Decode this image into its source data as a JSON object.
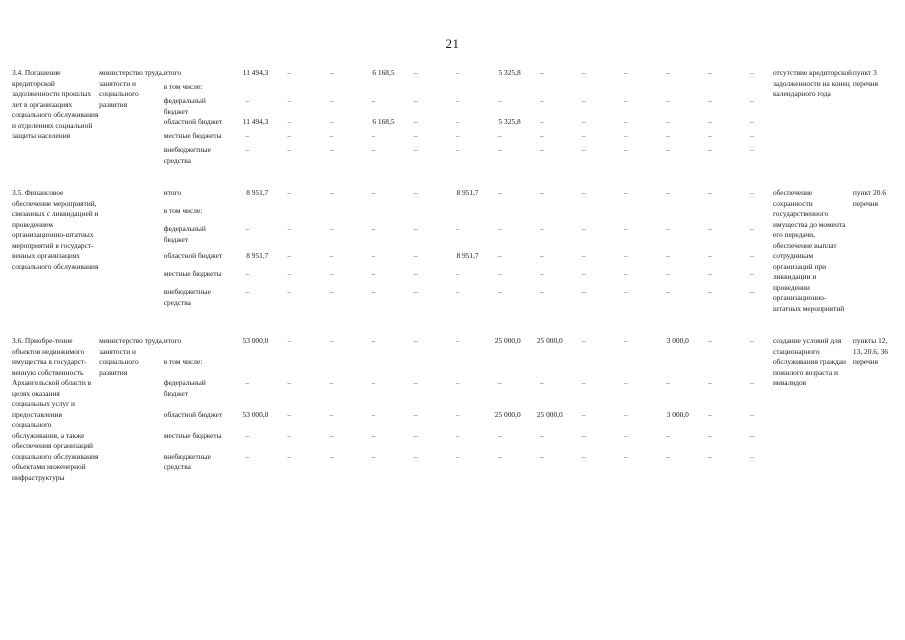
{
  "page": {
    "number": "21"
  },
  "table": {
    "columns": [
      "name",
      "executor",
      "funding_source",
      "total",
      "y1",
      "y2",
      "y3",
      "y4",
      "y5",
      "y6",
      "y7",
      "y8",
      "y9",
      "y10",
      "y11",
      "y12",
      "result",
      "item"
    ],
    "source_labels": [
      "итого",
      "в том числе:",
      "федеральный бюджет",
      "областной бюджет",
      "местные бюджеты",
      "внебюджетные средства"
    ],
    "rows": [
      {
        "name": "3.4. Погашение кредиторской задолженности прошлых лет в организациях социального обслуживания и отделениях социальной защиты населения",
        "executor": "министерство труда, занятости и социального развития",
        "result": "отсутствие кредиторской задолженности на конец календарного года",
        "item": "пункт 3 перечня",
        "values": {
          "итого": [
            "11 494,3",
            "–",
            "–",
            "6 168,5",
            "–",
            "–",
            "5 325,8",
            "–",
            "–",
            "–",
            "–",
            "–",
            "–"
          ],
          "в том числе:": [
            "",
            "",
            "",
            "",
            "",
            "",
            "",
            "",
            "",
            "",
            "",
            "",
            ""
          ],
          "федеральный бюджет": [
            "–",
            "–",
            "–",
            "–",
            "–",
            "–",
            "–",
            "–",
            "–",
            "–",
            "–",
            "–",
            "–"
          ],
          "областной бюджет": [
            "11 494,3",
            "–",
            "–",
            "6 168,5",
            "–",
            "–",
            "5 325,8",
            "–",
            "–",
            "–",
            "–",
            "–",
            "–"
          ],
          "местные бюджеты": [
            "–",
            "–",
            "–",
            "–",
            "–",
            "–",
            "–",
            "–",
            "–",
            "–",
            "–",
            "–",
            "–"
          ],
          "внебюджетные средства": [
            "–",
            "–",
            "–",
            "–",
            "–",
            "–",
            "–",
            "–",
            "–",
            "–",
            "–",
            "–",
            "–"
          ]
        }
      },
      {
        "name": "3.5. Финансовое обеспечение мероприятий, связанных с ликвидацией и проведением организационно-штатных мероприятий в государст-венных организациях социального обслуживания",
        "executor": "",
        "result": "обеспечение сохранности государственного имущества до момента его передачи, обеспечение выплат сотрудникам организаций при ликвидации и проведении организационно-штатных мероприятий",
        "item": "пункт 20.6 перечня",
        "values": {
          "итого": [
            "8 951,7",
            "–",
            "–",
            "–",
            "–",
            "8 951,7",
            "–",
            "–",
            "–",
            "–",
            "–",
            "–",
            "–"
          ],
          "в том числе:": [
            "",
            "",
            "",
            "",
            "",
            "",
            "",
            "",
            "",
            "",
            "",
            "",
            ""
          ],
          "федеральный бюджет": [
            "–",
            "–",
            "–",
            "–",
            "–",
            "–",
            "–",
            "–",
            "–",
            "–",
            "–",
            "–",
            "–"
          ],
          "областной бюджет": [
            "8 951,7",
            "–",
            "–",
            "–",
            "–",
            "8 951,7",
            "–",
            "–",
            "–",
            "–",
            "–",
            "–",
            "–"
          ],
          "местные бюджеты": [
            "–",
            "–",
            "–",
            "–",
            "–",
            "–",
            "–",
            "–",
            "–",
            "–",
            "–",
            "–",
            "–"
          ],
          "внебюджетные средства": [
            "–",
            "–",
            "–",
            "–",
            "–",
            "–",
            "–",
            "–",
            "–",
            "–",
            "–",
            "–",
            "–"
          ]
        }
      },
      {
        "name": "3.6. Приобре-тение  объектов недвижимого имущества в государст-венную собственность Архангельской области в целях оказания социальных услуг и предоставления социального обслуживания, а также обеспечения организаций социального обслуживания объектами инженерной инфраструктуры",
        "executor": "министерство труда, занятости и социального развития",
        "result": "создание условий для стационарного обслуживания граждан пожилого возраста и инвалидов",
        "item": "пункты 12, 13, 20.6, 36 перечня",
        "values": {
          "итого": [
            "53 000,0",
            "–",
            "–",
            "–",
            "–",
            "–",
            "25 000,0",
            "25 000,0",
            "–",
            "–",
            "3 000,0",
            "–",
            "–"
          ],
          "в том числе:": [
            "",
            "",
            "",
            "",
            "",
            "",
            "",
            "",
            "",
            "",
            "",
            "",
            ""
          ],
          "федеральный бюджет": [
            "–",
            "–",
            "–",
            "–",
            "–",
            "–",
            "–",
            "–",
            "–",
            "–",
            "–",
            "–",
            "–"
          ],
          "областной бюджет": [
            "53 000,0",
            "–",
            "–",
            "–",
            "–",
            "–",
            "25 000,0",
            "25 000,0",
            "–",
            "–",
            "3 000,0",
            "–",
            "–"
          ],
          "местные бюджеты": [
            "–",
            "–",
            "–",
            "–",
            "–",
            "–",
            "–",
            "–",
            "–",
            "–",
            "–",
            "–",
            "–"
          ],
          "внебюджетные средства": [
            "–",
            "–",
            "–",
            "–",
            "–",
            "–",
            "–",
            "–",
            "–",
            "–",
            "–",
            "–",
            "–"
          ]
        }
      }
    ]
  }
}
